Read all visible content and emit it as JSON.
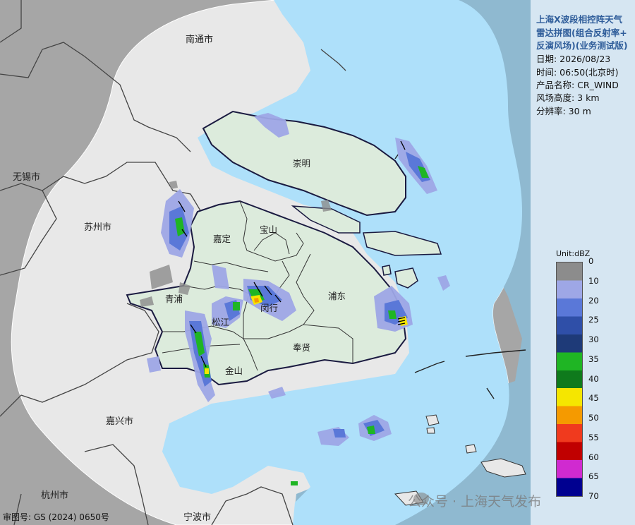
{
  "title_lines": [
    "上海X波段相控阵天气",
    "雷达拼图(组合反射率+",
    "反演风场)(业务测试版)"
  ],
  "info": {
    "date": "日期: 2026/08/23",
    "time": "时间: 06:50(北京时)",
    "product": "产品名称: CR_WIND",
    "height": "风场高度: 3 km",
    "resolution": "分辨率: 30 m"
  },
  "legend": {
    "unit": "Unit:dBZ",
    "ticks": [
      "0",
      "10",
      "20",
      "25",
      "30",
      "35",
      "40",
      "45",
      "50",
      "55",
      "60",
      "65",
      "70"
    ],
    "stops": [
      [
        "0",
        "#8c8c8c"
      ],
      [
        "10",
        "#9ea7e6"
      ],
      [
        "20",
        "#5a78d8"
      ],
      [
        "25",
        "#2f4fa8"
      ],
      [
        "30",
        "#1e3a78"
      ],
      [
        "35",
        "#1fb524"
      ],
      [
        "40",
        "#0f7a1c"
      ],
      [
        "45",
        "#f5e600"
      ],
      [
        "50",
        "#f59a00"
      ],
      [
        "55",
        "#f03a1e"
      ],
      [
        "60",
        "#c00000"
      ],
      [
        "65",
        "#d02ad0"
      ],
      [
        "70",
        "#000090"
      ]
    ]
  },
  "colors": {
    "outside": "#a6a6a6",
    "land_in_range": "#e8e8e8",
    "sea": "#aee0fa",
    "shanghai": "#dcebdc",
    "title_color": "#2f5d9a"
  },
  "places": {
    "nantong": "南通市",
    "wuxi": "无锡市",
    "suzhou": "苏州市",
    "jiaxing": "嘉兴市",
    "hangzhou": "杭州市",
    "ningbo": "宁波市",
    "chongming": "崇明",
    "baoshan": "宝山",
    "jiading": "嘉定",
    "qingpu": "青浦",
    "songjiang": "松江",
    "minhang": "闵行",
    "pudong": "浦东",
    "fengxian": "奉贤",
    "jinshan": "金山"
  },
  "approval": "审图号: GS (2024) 0650号",
  "watermark": "公众号 · 上海天气发布"
}
